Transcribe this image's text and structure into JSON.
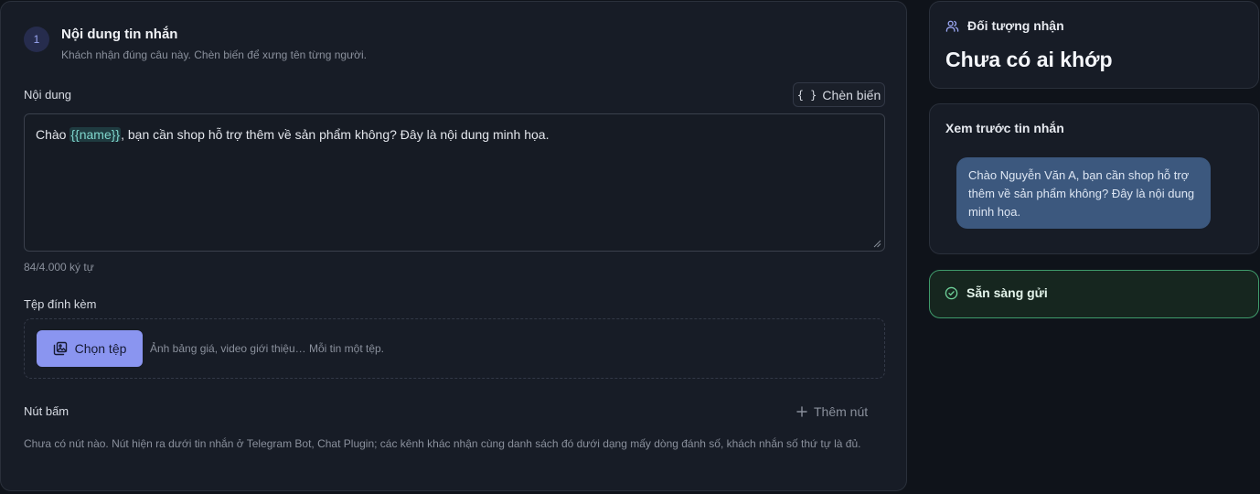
{
  "section": {
    "step_number": "1",
    "title": "Nội dung tin nhắn",
    "subtitle": "Khách nhận đúng câu này. Chèn biến để xưng tên từng người."
  },
  "content": {
    "label": "Nội dung",
    "insert_var_label": "Chèn biến",
    "message_before": "Chào ",
    "message_var": "{{name}}",
    "message_after": ", bạn cần shop hỗ trợ thêm về sản phẩm không? Đây là nội dung minh họa.",
    "char_count": "84/4.000 ký tự"
  },
  "attachment": {
    "label": "Tệp đính kèm",
    "choose_label": "Chọn tệp",
    "hint": "Ảnh bảng giá, video giới thiệu… Mỗi tin một tệp."
  },
  "buttons": {
    "label": "Nút bấm",
    "add_label": "Thêm nút",
    "hint": "Chưa có nút nào. Nút hiện ra dưới tin nhắn ở Telegram Bot, Chat Plugin; các kênh khác nhận cùng danh sách đó dưới dạng mấy dòng đánh số, khách nhắn số thứ tự là đủ."
  },
  "recipients": {
    "title": "Đối tượng nhận",
    "value": "Chưa có ai khớp"
  },
  "preview": {
    "title": "Xem trước tin nhắn",
    "message": "Chào Nguyễn Văn A, bạn cần shop hỗ trợ thêm về sản phẩm không? Đây là nội dung minh họa."
  },
  "status": {
    "label": "Sẵn sàng gửi"
  },
  "icons": {
    "insert_var": "curly-braces-icon",
    "choose_file": "image-stack-icon",
    "add": "plus-icon",
    "recipients": "users-icon",
    "status": "check-circle-icon",
    "resize": "resize-grip-icon"
  },
  "colors": {
    "accent": "#8a95f0",
    "success_border": "#3f9a6b",
    "bubble": "#3c587e",
    "variable": "#7fd6cd"
  }
}
